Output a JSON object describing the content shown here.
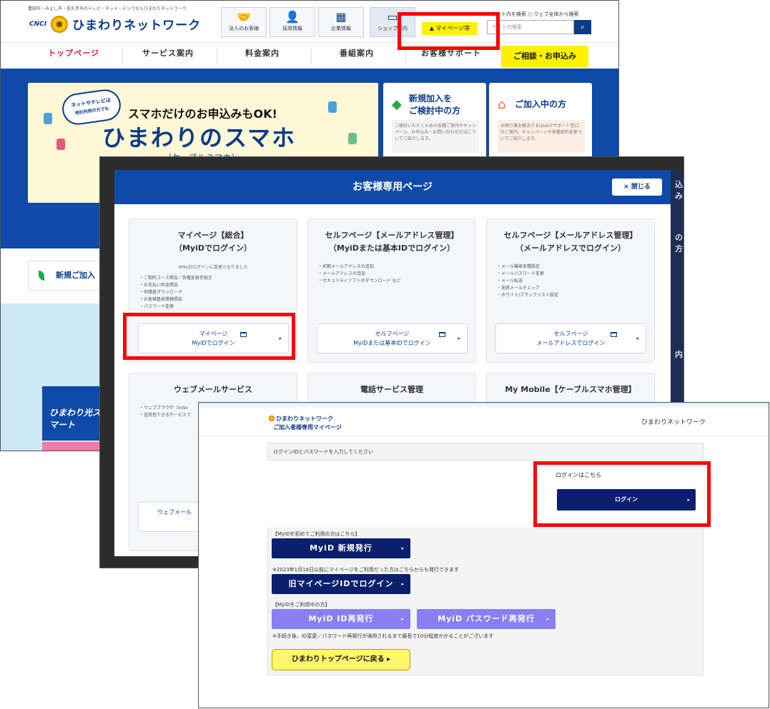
{
  "top_page": {
    "tagline": "豊田市・みよし市・長久手市のテレビ・ネット・デンワならひまわりネットワーク",
    "logo_small": "CNCI",
    "brand": "ひまわりネットワーク",
    "icon_buttons": [
      {
        "label": "法人のお客様",
        "icon": "handshake-icon"
      },
      {
        "label": "採用情報",
        "icon": "person-icon"
      },
      {
        "label": "企業情報",
        "icon": "building-icon"
      },
      {
        "label": "ショップ案内",
        "icon": "shop-icon"
      }
    ],
    "mypage_button": "マイページ等",
    "search_scope": "サイト内を検索 ○ ウェブ全体から検索",
    "search_placeholder": "サイト内検索",
    "nav": [
      "トップページ",
      "サービス案内",
      "料金案内",
      "番組案内",
      "お客様サポート"
    ],
    "nav_cta": "ご相談・お申込み",
    "banner": {
      "bubble_line1": "ネットやテレビは",
      "bubble_line2": "他社利用の方でも",
      "line1": "スマホだけのお申込みもOK!",
      "line2": "ひまわりのスマホ",
      "line3": "（ケーブルスマホ）"
    },
    "card_new": {
      "title_line1": "新規加入を",
      "title_line2": "ご検討中の方",
      "body": "ご検討いただくための各種ご案内やキャンペーン、お申込み・お問い合わせ方法についてご紹介します。"
    },
    "card_member": {
      "title": "ご加入中の方",
      "body": "お困り事を解決するQ&Aやサポート窓口のご案内、キャンペーンや各種契約変更ついてご紹介します。"
    },
    "new_join_label": "新規ご加入",
    "hikari_label": "ひまわり光スマート"
  },
  "modal": {
    "title": "お客様専用ページ",
    "close": "× 閉じる",
    "side_labels": [
      "込み",
      "の方",
      "内"
    ],
    "panels": [
      {
        "title_line1": "マイページ【総合】",
        "title_line2": "（MyiDでログイン）",
        "note": "※MyiDログインに変更となりました",
        "items": [
          "ご契約コース照会／各種変更手続き",
          "お支払い料金照会",
          "申請書ダウンロード",
          "お客様基本情報照会",
          "パスワード変更"
        ],
        "button_line1": "マイページ",
        "button_line2": "MyiDでログイン"
      },
      {
        "title_line1": "セルフページ【メールアドレス管理】",
        "title_line2": "（MyiDまたは基本IDでログイン）",
        "items": [
          "初期メールアドレスの追加",
          "メールアドレスの追加",
          "セキュリティソフトのダウンロード など"
        ],
        "button_line1": "セルフページ",
        "button_line2": "MyiDまたは基本IDでログイン"
      },
      {
        "title_line1": "セルフページ【メールアドレス管理】",
        "title_line2": "（メールアドレスでログイン）",
        "items": [
          "メール機能各種設定",
          "メールパスワード変更",
          "メール転送",
          "迷惑メールチェック",
          "ホワイト/ブラックリスト設定"
        ],
        "button_line1": "セルフページ",
        "button_line2": "メールアドレスでログイン"
      }
    ],
    "lower_panels": [
      {
        "title": "ウェブメールサービス",
        "items": [
          "ウェブブラウザ（Inter",
          "送受信できるサービスで"
        ],
        "button": "ウェブメール"
      },
      {
        "title": "電話サービス管理"
      },
      {
        "title": "My Mobile【ケーブルスマホ管理】"
      }
    ]
  },
  "login_page": {
    "logo_line1": "ひまわりネットワーク",
    "logo_line2": "ご加入者様専用マイページ",
    "brand_right": "ひまわりネットワーク",
    "instruction": "ログインIDとパスワードを入力してください",
    "login_label": "ログインはこちら",
    "login_button": "ログイン",
    "first_time_label": "【MyiDを初めてご利用の方はこちら】",
    "new_issue_button": "MyiD 新規発行",
    "legacy_note": "※2023年1月18日以前にマイページをご利用だった方はこちらからも発行できます",
    "legacy_button": "旧マイページIDでログイン",
    "current_label": "【MyiDをご利用中の方】",
    "reissue_id_button": "MyiD ID再発行",
    "reissue_pw_button": "MyiD パスワード再発行",
    "reissue_note": "※手続き後、ID変更／パスワード再発行が適用されるまで最長で10分程度かかることがございます",
    "back_button": "ひまわりトップページに戻る"
  },
  "colors": {
    "brand_blue": "#0f4aa8",
    "navy_button": "#0b1f6e",
    "violet_button": "#8a7ff2",
    "yellow": "#fff100",
    "highlight": "#ff0000"
  }
}
